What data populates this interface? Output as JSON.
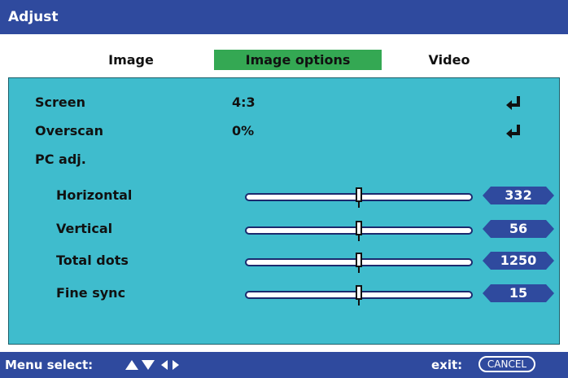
{
  "window": {
    "title": "Adjust"
  },
  "tabs": [
    {
      "label": "Image",
      "active": false
    },
    {
      "label": "Image options",
      "active": true
    },
    {
      "label": "Video",
      "active": false
    }
  ],
  "settings": {
    "screen": {
      "label": "Screen",
      "value": "4:3"
    },
    "overscan": {
      "label": "Overscan",
      "value": "0%"
    },
    "pc_adj": {
      "label": "PC adj."
    }
  },
  "sliders": [
    {
      "label": "Horizontal",
      "value": "332",
      "level": 0.5
    },
    {
      "label": "Vertical",
      "value": "56",
      "level": 0.5
    },
    {
      "label": "Total dots",
      "value": "1250",
      "level": 0.5
    },
    {
      "label": "Fine sync",
      "value": "15",
      "level": 0.5
    }
  ],
  "status": {
    "menu_select": "Menu select:",
    "exit_label": "exit:",
    "cancel_label": "CANCEL"
  },
  "colors": {
    "accent": "#2f4a9e",
    "panel": "#3fbccd",
    "active_tab": "#34a853",
    "badge": "#2f4a9e"
  },
  "icons": {
    "enter": "enter-return-icon",
    "nav": "navigation-arrows-icon"
  }
}
